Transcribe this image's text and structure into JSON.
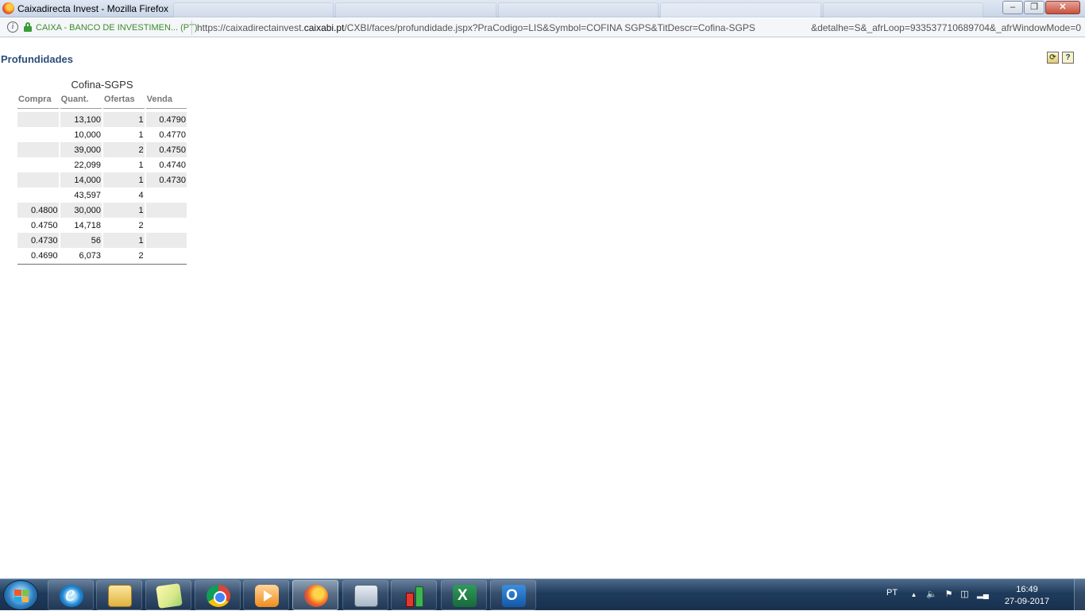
{
  "window": {
    "title": "Caixadirecta Invest - Mozilla Firefox",
    "controls": {
      "minimize": "–",
      "maximize": "❐",
      "close": "✕"
    }
  },
  "urlbar": {
    "identity": "CAIXA - BANCO DE INVESTIMEN...  (PT)",
    "url_prefix": "https://caixadirectainvest.",
    "url_domain": "caixabi.pt",
    "url_path": "/CXBI/faces/profundidade.jspx?PraCodigo=LIS&Symbol=COFINA SGPS&TitDescr=Cofina-SGPS",
    "url_tail": "&detalhe=S&_afrLoop=933537710689704&_afrWindowMode=0"
  },
  "page": {
    "title": "Profundidades",
    "tools": {
      "refresh": "⟳",
      "help": "?"
    }
  },
  "depth": {
    "caption": "Cofina-SGPS",
    "headers": [
      "Compra",
      "Quant.",
      "Ofertas",
      "Venda"
    ],
    "rows": [
      {
        "compra": "",
        "quant": "13,100",
        "ofertas": "1",
        "venda": "0.4790"
      },
      {
        "compra": "",
        "quant": "10,000",
        "ofertas": "1",
        "venda": "0.4770"
      },
      {
        "compra": "",
        "quant": "39,000",
        "ofertas": "2",
        "venda": "0.4750"
      },
      {
        "compra": "",
        "quant": "22,099",
        "ofertas": "1",
        "venda": "0.4740"
      },
      {
        "compra": "",
        "quant": "14,000",
        "ofertas": "1",
        "venda": "0.4730"
      },
      {
        "compra": "",
        "quant": "43,597",
        "ofertas": "4",
        "venda": ""
      },
      {
        "compra": "0.4800",
        "quant": "30,000",
        "ofertas": "1",
        "venda": ""
      },
      {
        "compra": "0.4750",
        "quant": "14,718",
        "ofertas": "2",
        "venda": ""
      },
      {
        "compra": "0.4730",
        "quant": "56",
        "ofertas": "1",
        "venda": ""
      },
      {
        "compra": "0.4690",
        "quant": "6,073",
        "ofertas": "2",
        "venda": ""
      }
    ]
  },
  "taskbar": {
    "apps": [
      "internet-explorer",
      "file-explorer",
      "sticky-notes",
      "chrome",
      "media-player",
      "firefox",
      "calculator",
      "trading-chart",
      "excel",
      "outlook"
    ],
    "language": "PT",
    "tray_arrow": "▲",
    "time": "16:49",
    "date": "27-09-2017"
  }
}
